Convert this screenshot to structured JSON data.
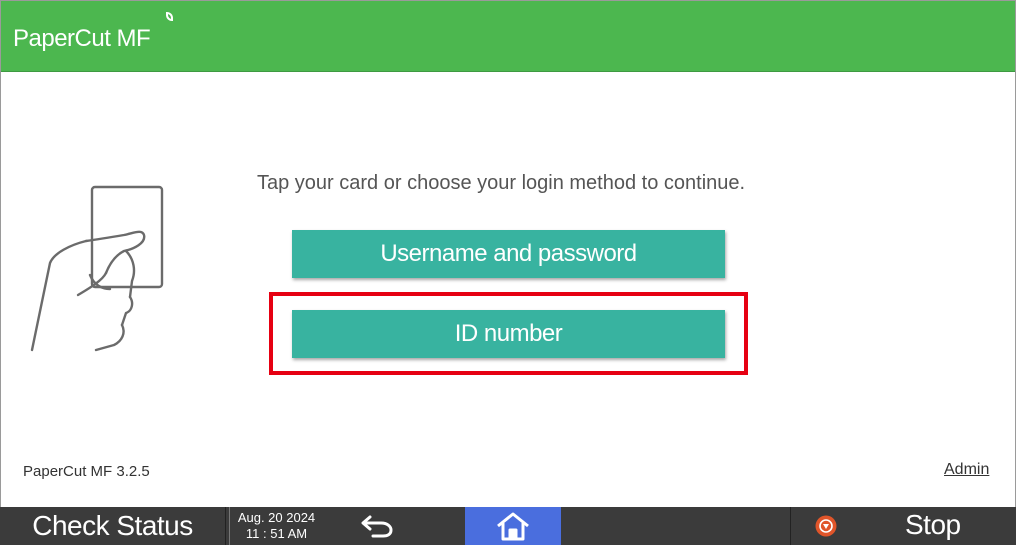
{
  "header": {
    "brand": "PaperCut MF",
    "accent_color": "#4cb74f"
  },
  "login": {
    "prompt": "Tap your card or choose your login method to continue.",
    "card_icon": "hand-card-icon",
    "methods": [
      {
        "label": "Username and password"
      },
      {
        "label": "ID number",
        "highlighted": true
      }
    ],
    "button_color": "#38b3a0",
    "highlight_color": "#e60012"
  },
  "footer": {
    "version": "PaperCut MF 3.2.5",
    "admin_link": "Admin"
  },
  "taskbar": {
    "check_status": "Check Status",
    "date": "Aug. 20 2024",
    "time": "11 : 51 AM",
    "back_icon": "back-arrow-icon",
    "home_icon": "home-icon",
    "stop_icon": "stop-icon",
    "stop_label": "Stop"
  }
}
